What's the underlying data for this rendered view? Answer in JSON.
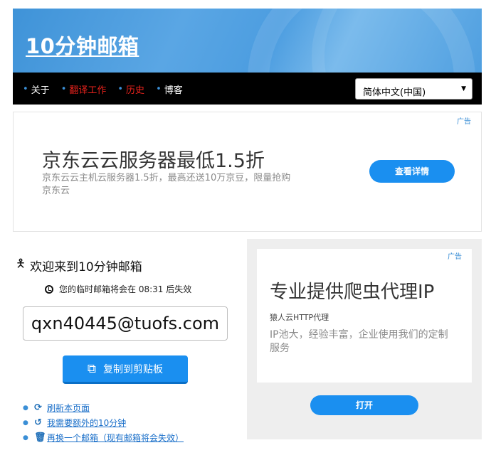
{
  "header": {
    "logo": "10分钟邮箱"
  },
  "nav": {
    "items": [
      {
        "label": "关于",
        "color": "#ffffff"
      },
      {
        "label": "翻译工作",
        "color": "#e8221c"
      },
      {
        "label": "历史",
        "color": "#e8221c"
      },
      {
        "label": "博客",
        "color": "#ffffff"
      }
    ],
    "language": "简体中文(中国)"
  },
  "ad_top": {
    "tag": "广告",
    "title": "京东云云服务器最低1.5折",
    "description": "京东云云主机云服务器1.5折，最高还送10万京豆，限量抢购",
    "advertiser": "京东云",
    "button": "查看详情"
  },
  "mailbox": {
    "welcome": "欢迎来到10分钟邮箱",
    "expire_text": "您的临时邮箱将会在 08:31 后失效",
    "email": "qxn40445@tuofs.com",
    "copy_button": "复制到剪贴板",
    "links": [
      {
        "label": "刷新本页面",
        "icon": "refresh-icon"
      },
      {
        "label": "我需要额外的10分钟",
        "icon": "history-icon"
      },
      {
        "label": "再换一个邮箱（现有邮箱将会失效）",
        "icon": "trash-icon"
      }
    ]
  },
  "ad_side": {
    "tag": "广告",
    "title": "专业提供爬虫代理IP",
    "brand": "猿人云HTTP代理",
    "description": "IP池大，经验丰富，企业使用我们的定制服务",
    "button": "打开"
  },
  "colors": {
    "accent": "#1a8ff0",
    "header": "#4c9de0",
    "nav_bg": "#000000",
    "link": "#1a6fc9"
  }
}
